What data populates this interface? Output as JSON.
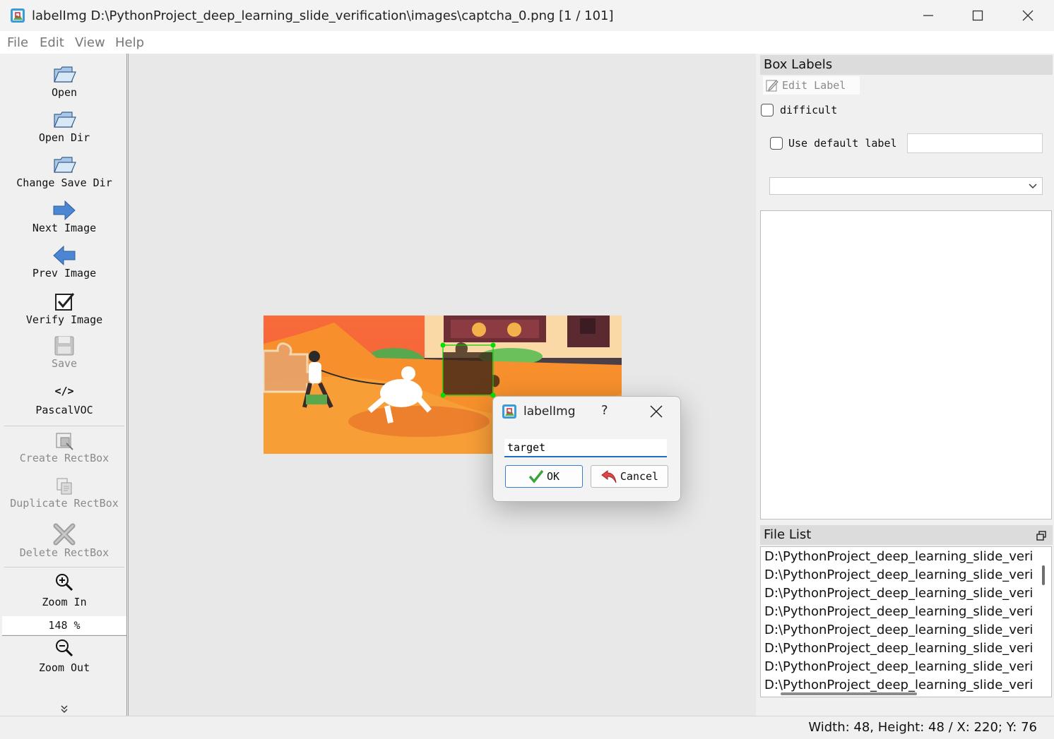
{
  "window": {
    "title": "labelImg D:\\PythonProject_deep_learning_slide_verification\\images\\captcha_0.png [1 / 101]",
    "icon": "labelimg-app-icon"
  },
  "menu": [
    "File",
    "Edit",
    "View",
    "Help"
  ],
  "toolbar": {
    "open": "Open",
    "open_dir": "Open Dir",
    "change_save_dir": "Change Save Dir",
    "next_image": "Next Image",
    "prev_image": "Prev Image",
    "verify_image": "Verify Image",
    "save": "Save",
    "format_symbol": "</>",
    "format": "PascalVOC",
    "create_rectbox": "Create RectBox",
    "duplicate_rectbox": "Duplicate RectBox",
    "delete_rectbox": "Delete RectBox",
    "zoom_in": "Zoom In",
    "zoom_level": "148 %",
    "zoom_out": "Zoom Out"
  },
  "dialog": {
    "title": "labelImg",
    "help": "?",
    "input_value": "target",
    "ok_label": "OK",
    "cancel_label": "Cancel"
  },
  "box_labels": {
    "title": "Box Labels",
    "edit_label": "Edit Label",
    "difficult": "difficult",
    "use_default_label": "Use default label",
    "default_label_value": "",
    "combo_value": ""
  },
  "file_list": {
    "title": "File List",
    "items": [
      "D:\\PythonProject_deep_learning_slide_verific",
      "D:\\PythonProject_deep_learning_slide_verific",
      "D:\\PythonProject_deep_learning_slide_verific",
      "D:\\PythonProject_deep_learning_slide_verific",
      "D:\\PythonProject_deep_learning_slide_verific",
      "D:\\PythonProject_deep_learning_slide_verific",
      "D:\\PythonProject_deep_learning_slide_verific",
      "D:\\PythonProject_deep_learning_slide_verific"
    ]
  },
  "status": "Width: 48, Height: 48 / X: 220; Y: 76",
  "colors": {
    "accent": "#1e6fc7",
    "selection_box": "#00d000",
    "canvas_bg": "#e8e8e8"
  }
}
